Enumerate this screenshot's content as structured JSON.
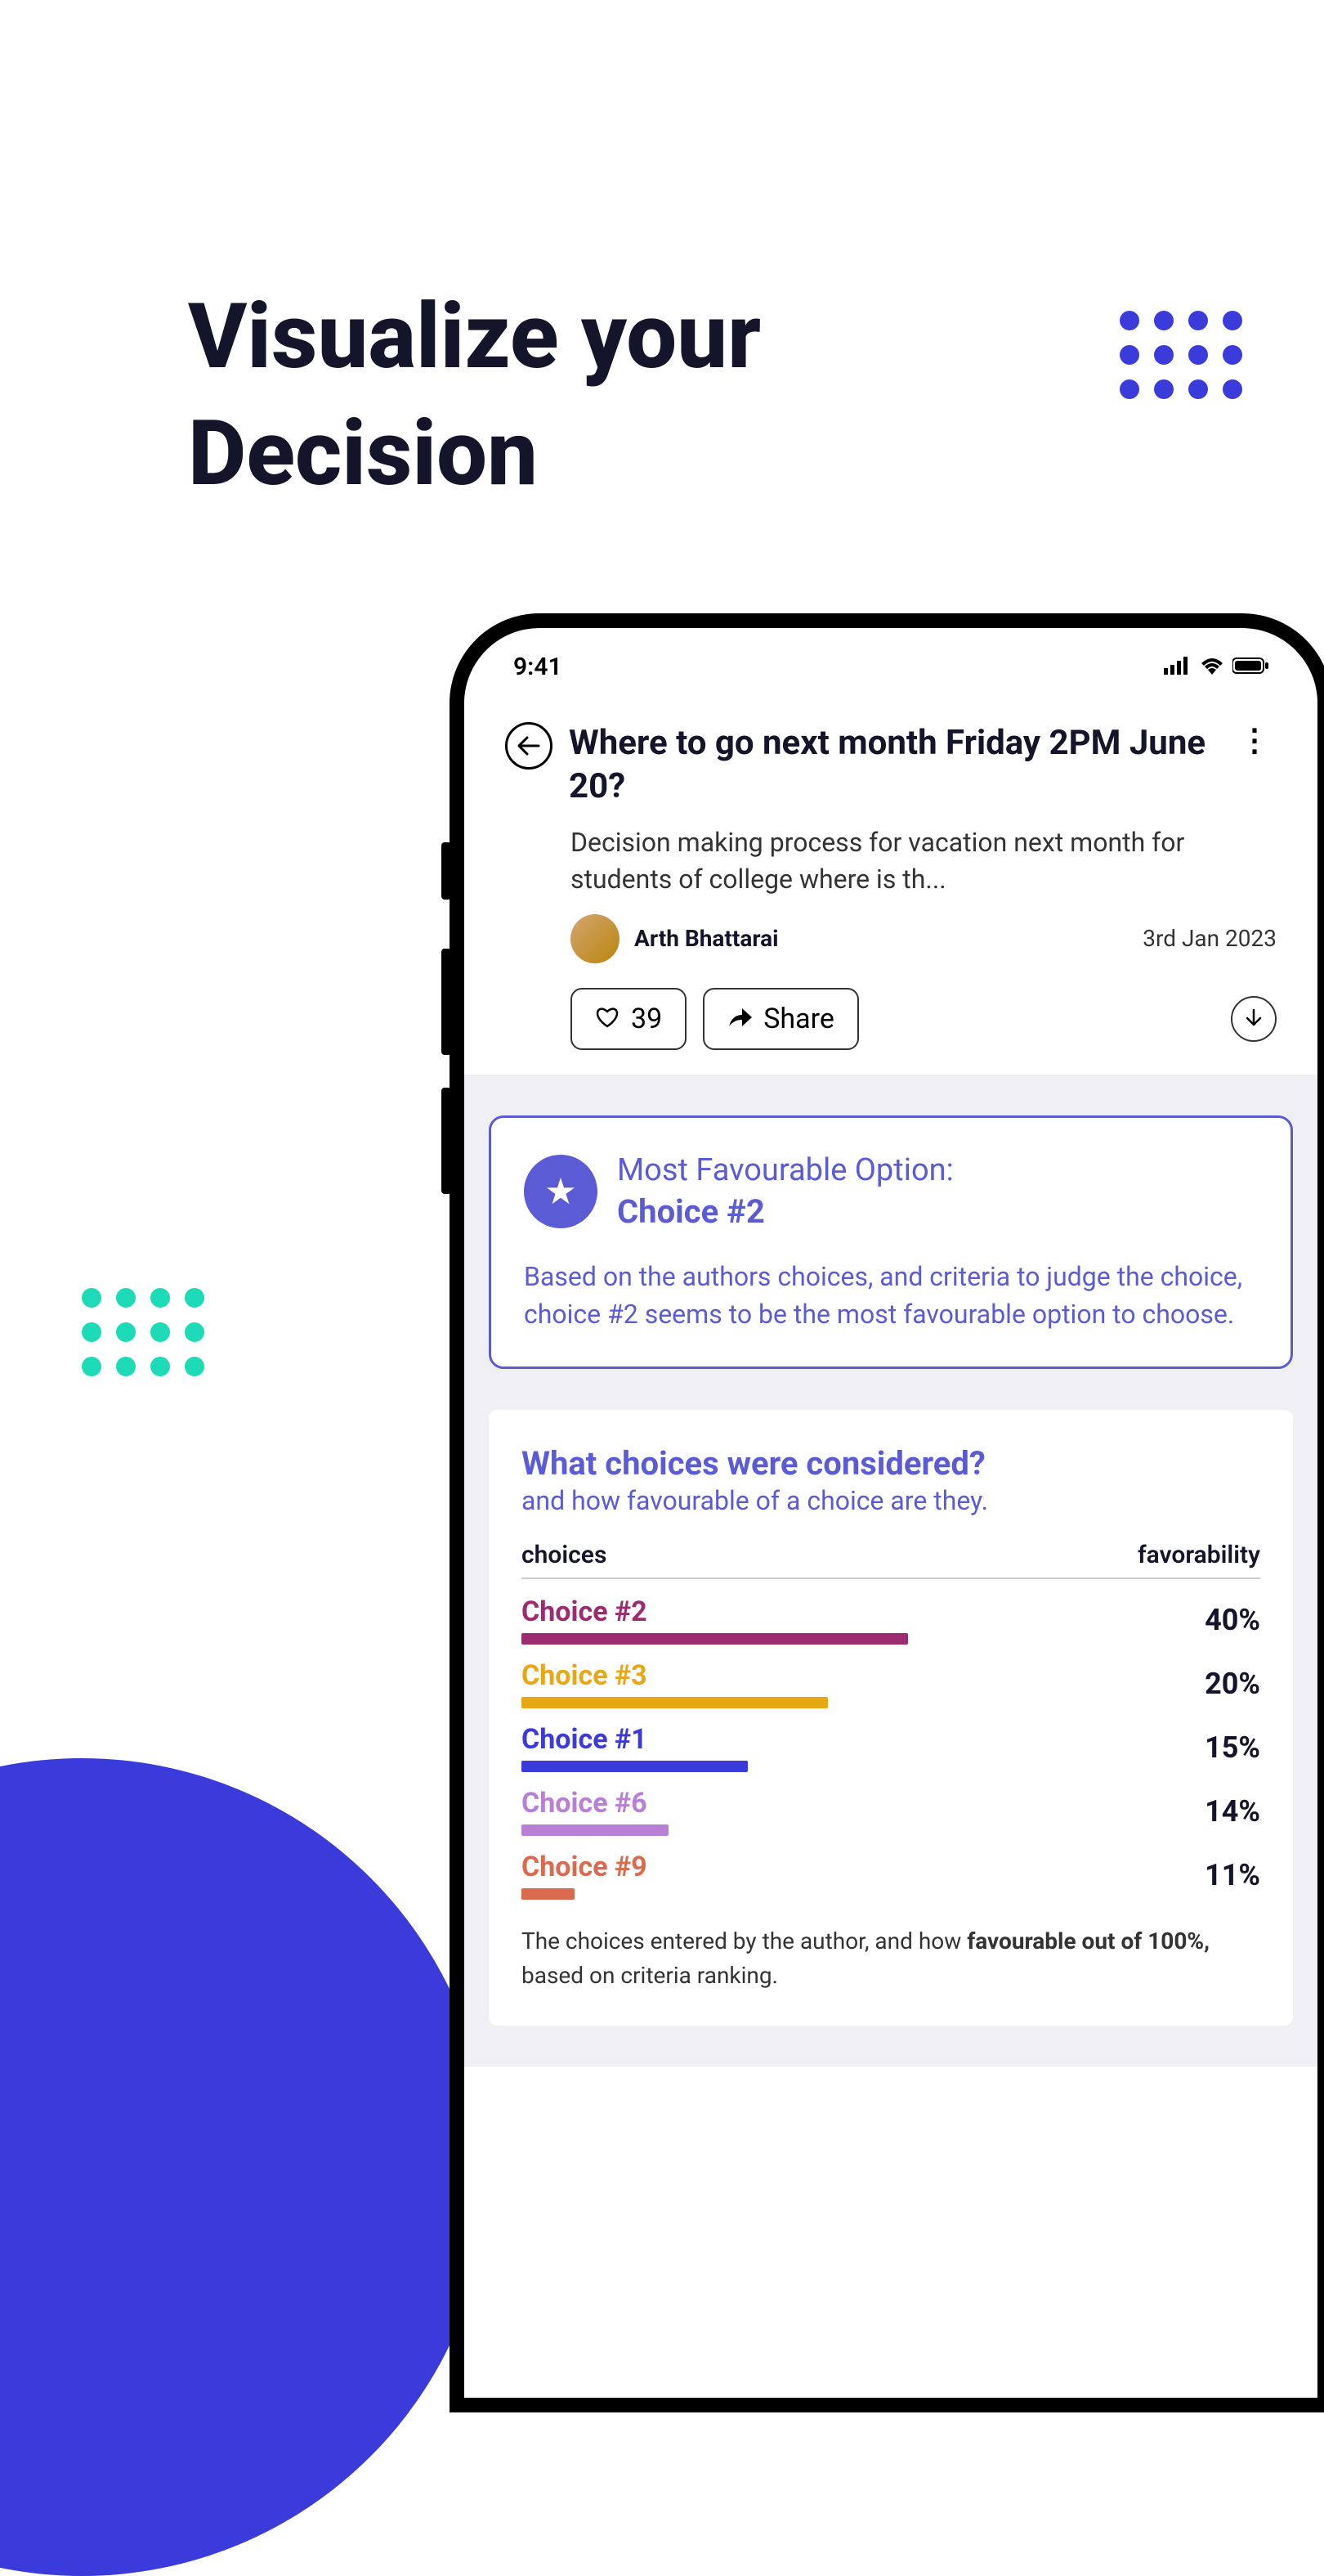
{
  "page": {
    "title_line1": "Visualize your",
    "title_line2": "Decision"
  },
  "status": {
    "time": "9:41"
  },
  "header": {
    "question": "Where to go next month Friday 2PM June 20?",
    "description": "Decision making process for vacation next month for students of college where is th...",
    "author": "Arth Bhattarai",
    "date": "3rd Jan 2023",
    "likes": "39",
    "share": "Share"
  },
  "favourable": {
    "label": "Most Favourable Option:",
    "choice": "Choice #2",
    "desc": "Based on the authors choices, and criteria to judge the choice, choice #2 seems to be the most favourable option to choose."
  },
  "choices": {
    "title": "What choices were considered?",
    "subtitle": "and how favourable of a choice are they.",
    "col1": "choices",
    "col2": "favorability",
    "items": [
      {
        "name": "Choice #2",
        "pct": "40%",
        "width": 58,
        "color": "#9B2C6F"
      },
      {
        "name": "Choice #3",
        "pct": "20%",
        "width": 46,
        "color": "#E6A817"
      },
      {
        "name": "Choice #1",
        "pct": "15%",
        "width": 34,
        "color": "#3B3BDB"
      },
      {
        "name": "Choice #6",
        "pct": "14%",
        "width": 22,
        "color": "#B87FD6"
      },
      {
        "name": "Choice #9",
        "pct": "11%",
        "width": 8,
        "color": "#D96B4F"
      }
    ],
    "footer_pre": "The choices entered by the author, and how ",
    "footer_bold": "favourable out of 100%,",
    "footer_post": " based on criteria ranking."
  },
  "chart_data": {
    "type": "bar",
    "title": "What choices were considered?",
    "xlabel": "choices",
    "ylabel": "favorability",
    "categories": [
      "Choice #2",
      "Choice #3",
      "Choice #1",
      "Choice #6",
      "Choice #9"
    ],
    "values": [
      40,
      20,
      15,
      14,
      11
    ],
    "colors": [
      "#9B2C6F",
      "#E6A817",
      "#3B3BDB",
      "#B87FD6",
      "#D96B4F"
    ],
    "ylim": [
      0,
      100
    ]
  }
}
